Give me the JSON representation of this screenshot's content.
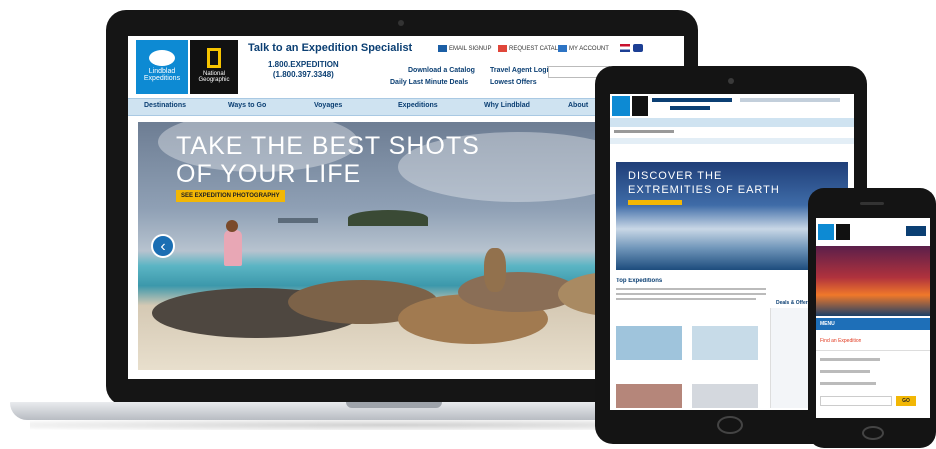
{
  "laptop_site": {
    "header": {
      "talk_text": "Talk to an Expedition Specialist",
      "phone_line1": "1.800.EXPEDITION",
      "phone_line2": "(1.800.397.3348)",
      "util_links": [
        "EMAIL SIGNUP",
        "REQUEST CATALOG",
        "MY ACCOUNT"
      ],
      "link_catalog": "Download a Catalog",
      "link_last_minute": "Daily Last Minute Deals",
      "link_travel": "Travel Agent Login",
      "link_offers": "Lowest Offers"
    },
    "logos": {
      "brand": "Lindblad Expeditions",
      "partner": "National Geographic"
    },
    "nav": [
      "Destinations",
      "Ways to Go",
      "Voyages",
      "Expeditions",
      "Why Lindblad",
      "About"
    ],
    "hero": {
      "title_line1": "TAKE THE BEST SHOTS",
      "title_line2": "OF YOUR LIFE",
      "cta": "SEE EXPEDITION PHOTOGRAPHY",
      "prev_arrow": "‹"
    }
  },
  "tablet_site": {
    "hero_line1": "DISCOVER THE",
    "hero_line2": "EXTREMITIES OF EARTH",
    "section_title": "Top Expeditions",
    "sidebar_title": "Deals & Offers"
  },
  "phone_site": {
    "menu_label": "MENU",
    "link_item": "Find an Expedition",
    "button": "GO"
  },
  "colors": {
    "brand_blue": "#0d8ad3",
    "nav_blue": "#cfe3f1",
    "cta_yellow": "#f2b705",
    "device_black": "#151515"
  }
}
